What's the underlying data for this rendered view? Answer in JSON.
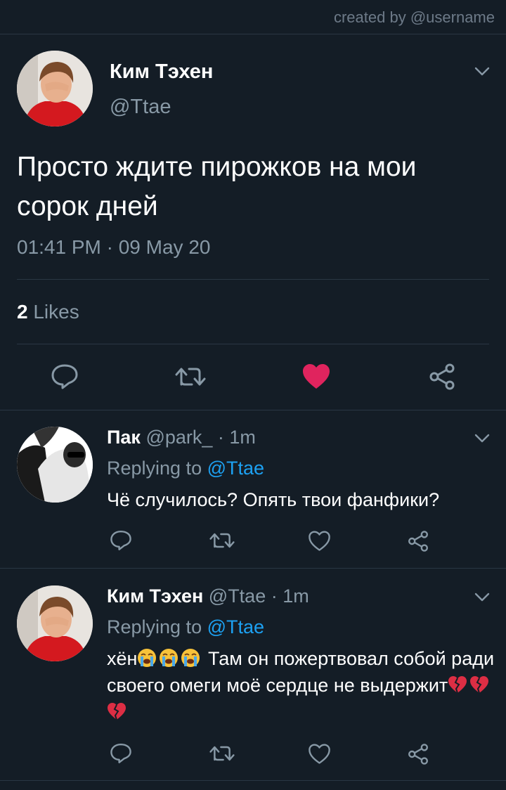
{
  "credit": "created by @username",
  "main_tweet": {
    "author_name": "Ким Тэхен",
    "handle": "@Ttae",
    "text": "Просто ждите пирожков на мои сорок дней",
    "timestamp": "01:41 PM · 09 May 20",
    "likes_count": "2",
    "likes_label": " Likes",
    "liked": true
  },
  "replies": [
    {
      "author_name": "Пак",
      "meta": " @park_ · 1m",
      "replying_label": "Replying to ",
      "replying_handle": "@Ttae",
      "text": "Чё случилось? Опять твои фанфики?"
    },
    {
      "author_name": "Ким Тэхен",
      "meta": " @Ttae · 1m",
      "replying_label": "Replying to ",
      "replying_handle": "@Ttae",
      "text_prefix": "хён",
      "text_middle": " Там он пожертвовал собой ради своего омеги моё сердце не выдержит",
      "emoji_after_prefix": [
        "crying-face",
        "crying-face",
        "crying-face"
      ],
      "emoji_at_end": [
        "broken-heart",
        "broken-heart",
        "broken-heart"
      ]
    }
  ],
  "colors": {
    "background": "#141d26",
    "divider": "#2a3744",
    "muted": "#8899a6",
    "link": "#1da1f2",
    "like_active": "#e0245e"
  }
}
